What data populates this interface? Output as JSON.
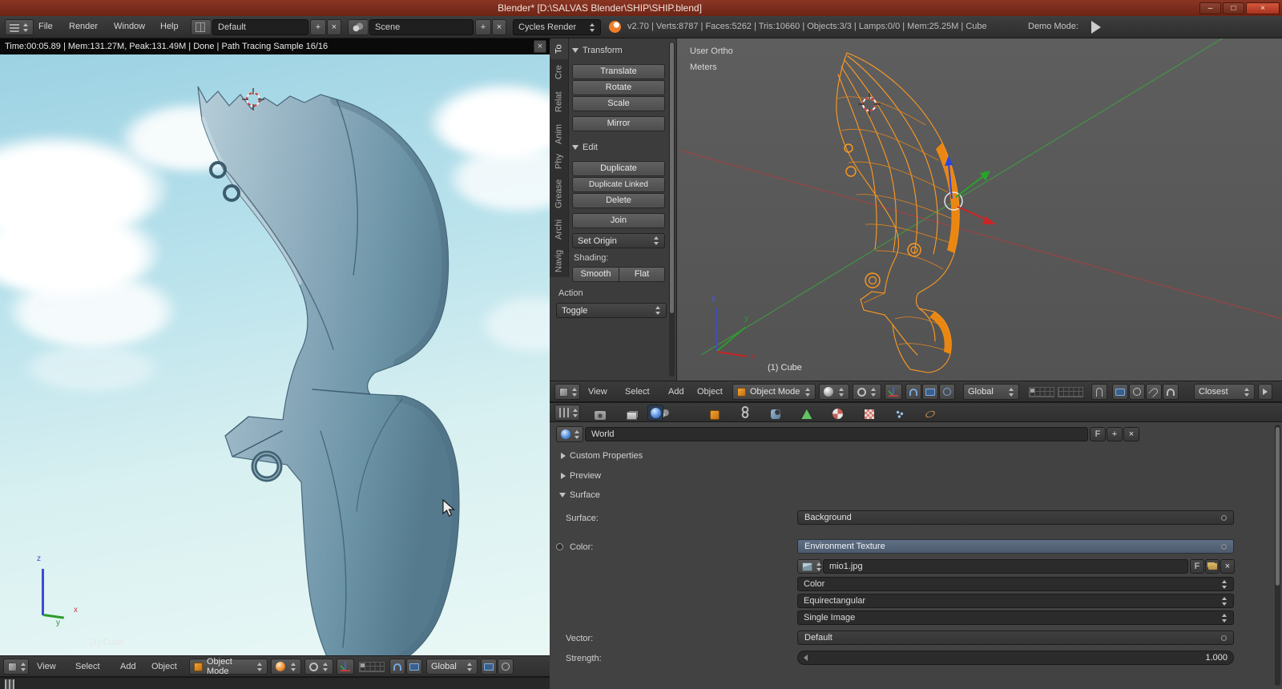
{
  "window": {
    "title": "Blender* [D:\\SALVAS Blender\\SHIP\\SHIP.blend]",
    "minimize": "–",
    "maximize": "□",
    "close": "×"
  },
  "info": {
    "menus": [
      "File",
      "Render",
      "Window",
      "Help"
    ],
    "layout": "Default",
    "scene": "Scene",
    "engine": "Cycles Render",
    "add": "+",
    "remove": "×",
    "stats": "v2.70 | Verts:8787 | Faces:5262 | Tris:10660 | Objects:3/3 | Lamps:0/0 | Mem:25.25M | Cube",
    "demo": "Demo Mode:"
  },
  "render": {
    "status": "Time:00:05.89 | Mem:131.27M, Peak:131.49M | Done | Path Tracing Sample 16/16",
    "object": "(1) Cube"
  },
  "axis": {
    "x": "x",
    "y": "y",
    "z": "z"
  },
  "shelf": {
    "tabs": [
      "To",
      "Cre",
      "Relat",
      "Anim",
      "Phy",
      "Grease",
      "Archi",
      "Navig"
    ],
    "transform_title": "Transform",
    "translate": "Translate",
    "rotate": "Rotate",
    "scale": "Scale",
    "mirror": "Mirror",
    "edit_title": "Edit",
    "duplicate": "Duplicate",
    "duplicate_linked": "Duplicate Linked",
    "del": "Delete",
    "join": "Join",
    "set_origin": "Set Origin",
    "shading": "Shading:",
    "smooth": "Smooth",
    "flat": "Flat",
    "action_title": "Action",
    "action_value": "Toggle"
  },
  "view3d": {
    "view_name": "User Ortho",
    "units": "Meters",
    "object": "(1) Cube"
  },
  "hdr": {
    "menus": [
      "View",
      "Select",
      "Add",
      "Object"
    ],
    "mode": "Object Mode",
    "orientation": "Global",
    "snap_target": "Closest"
  },
  "props": {
    "world_name": "World",
    "fake_user": "F",
    "add": "+",
    "remove": "×",
    "panel_custom": "Custom Properties",
    "panel_preview": "Preview",
    "panel_surface": "Surface",
    "surface_label": "Surface:",
    "surface_value": "Background",
    "color_label": "Color:",
    "color_value": "Environment Texture",
    "image_name": "mio1.jpg",
    "color_space": "Color",
    "projection": "Equirectangular",
    "source": "Single Image",
    "vector_label": "Vector:",
    "vector_value": "Default",
    "strength_label": "Strength:",
    "strength_value": "1.000"
  },
  "colors": {
    "titlebar": "#7d2b1c",
    "wireframe_orange": "#ff9a20",
    "axis_x_red": "#b23d3d",
    "axis_y_green": "#3da43d",
    "axis_z_blue": "#3b4bd8",
    "snap_blue": "#6f9fd8"
  }
}
